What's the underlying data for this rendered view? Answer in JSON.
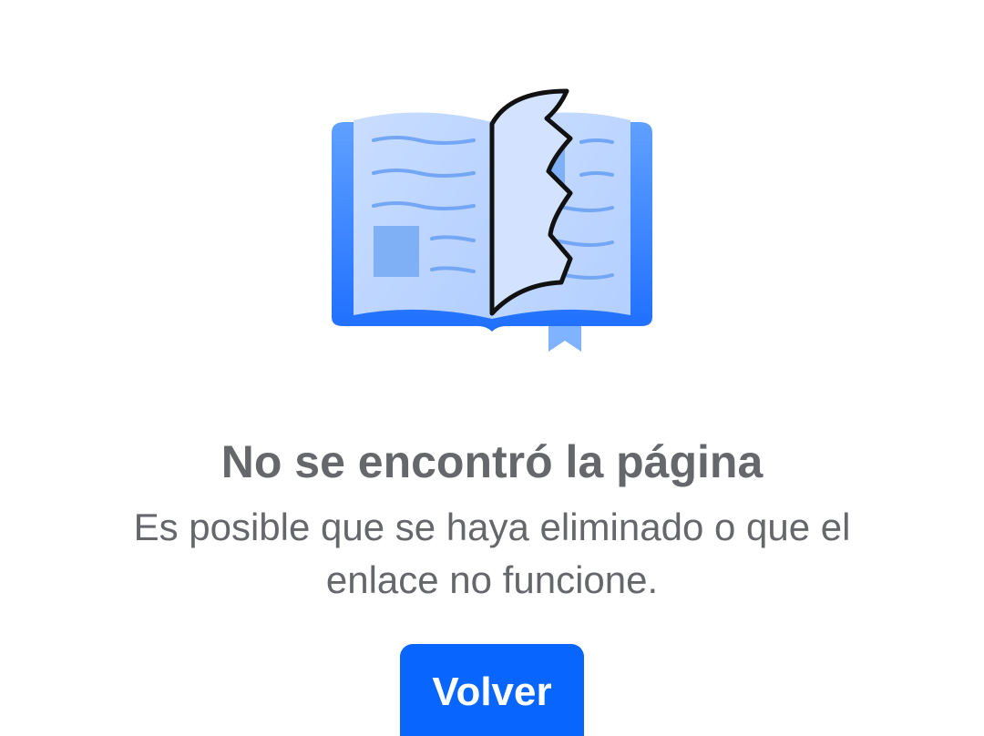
{
  "illustration": {
    "icon": "torn-book-icon",
    "accent_color": "#0866ff"
  },
  "error": {
    "title": "No se encontró la página",
    "message": "Es posible que se haya eliminado o que el enlace no funcione."
  },
  "actions": {
    "back_label": "Volver",
    "button_color": "#0866ff"
  },
  "colors": {
    "text_secondary": "#65676b",
    "background": "#ffffff"
  }
}
